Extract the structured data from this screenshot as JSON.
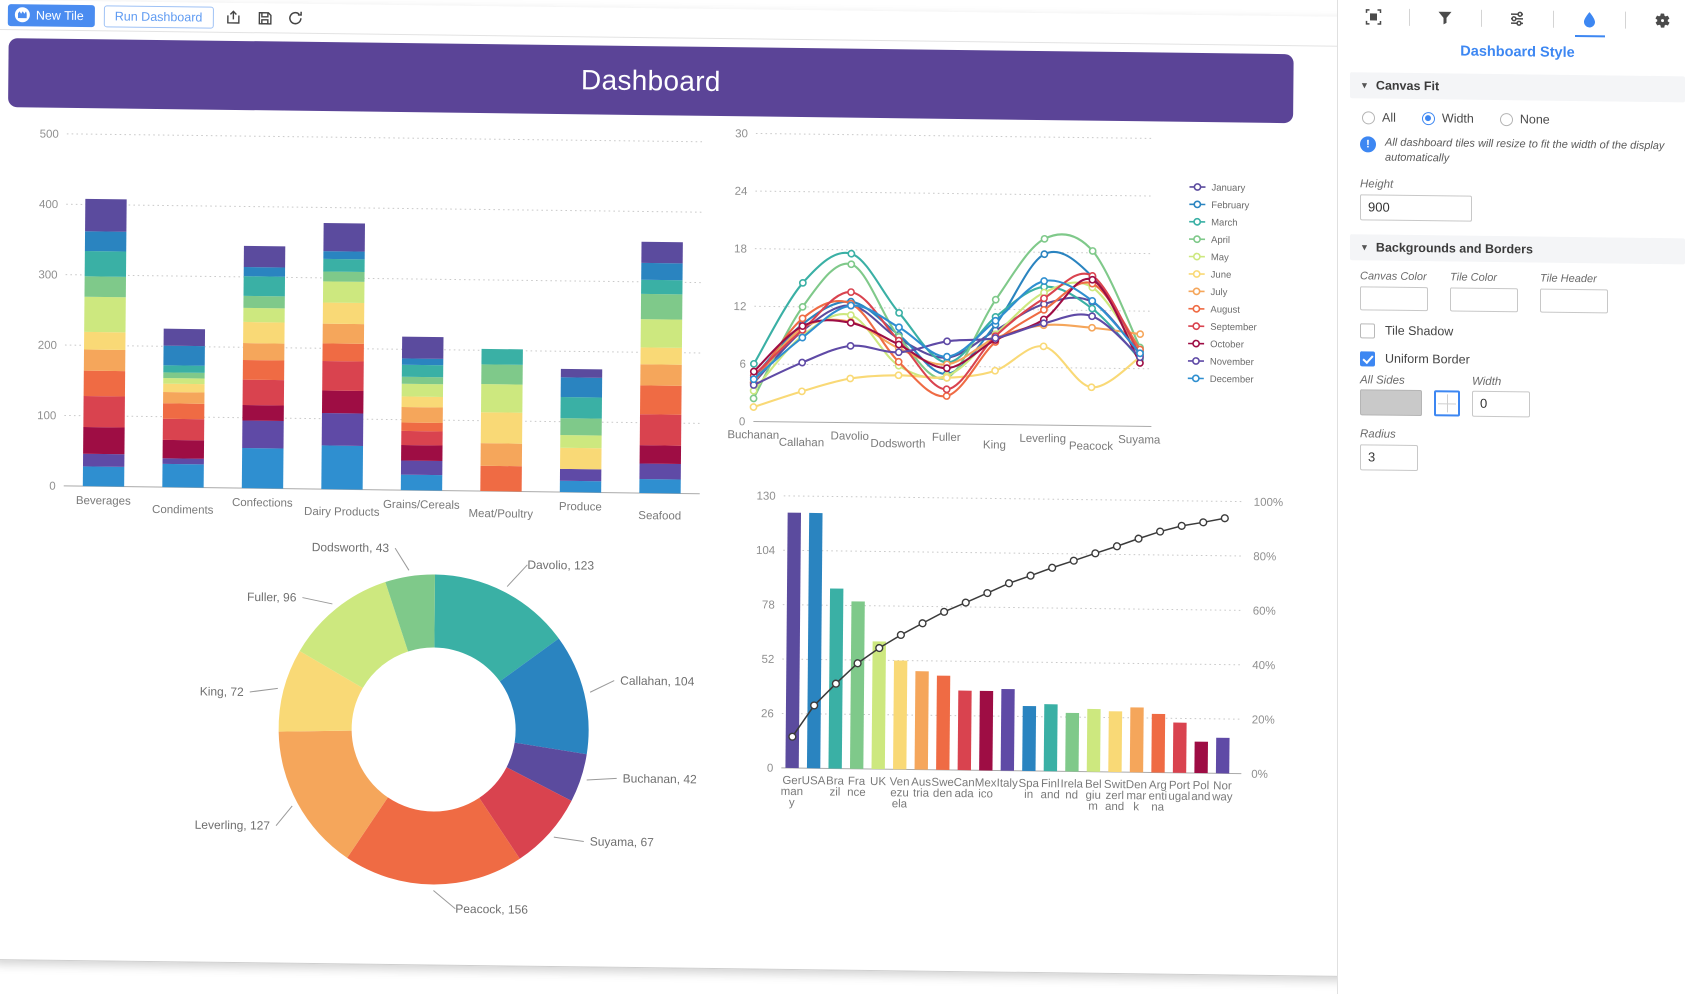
{
  "toolbar": {
    "new_tile": "New Tile",
    "run_dashboard": "Run Dashboard",
    "export_icon": "export-icon",
    "save_icon": "save-icon",
    "refresh_icon": "refresh-icon"
  },
  "banner": {
    "title": "Dashboard"
  },
  "panel": {
    "title": "Dashboard Style",
    "icons": [
      "select-tiles-icon",
      "filter-icon",
      "settings-sliders-icon",
      "style-droplet-icon",
      "gear-icon"
    ],
    "canvas_fit": {
      "heading": "Canvas Fit",
      "options": [
        "All",
        "Width",
        "None"
      ],
      "selected": "Width",
      "info": "All dashboard tiles will resize to fit the width of the display automatically",
      "height_label": "Height",
      "height_value": "900"
    },
    "backgrounds": {
      "heading": "Backgrounds and Borders",
      "canvas_color_label": "Canvas Color",
      "tile_color_label": "Tile Color",
      "tile_header_label": "Tile Header",
      "tile_shadow_label": "Tile Shadow",
      "tile_shadow_checked": false,
      "uniform_border_label": "Uniform Border",
      "uniform_border_checked": true,
      "all_sides_label": "All Sides",
      "width_label": "Width",
      "width_value": "0",
      "radius_label": "Radius",
      "radius_value": "3"
    }
  },
  "colors": {
    "accent": "#3d87f2",
    "banner": "#5b4497",
    "palette": [
      "#5b4b9e",
      "#2a84c0",
      "#3ab0a5",
      "#7fc98a",
      "#cde87f",
      "#f9d976",
      "#f5a65b",
      "#ef6b44",
      "#d9434f",
      "#9e0d44",
      "#5f4aa6",
      "#2f8fd0"
    ]
  },
  "chart_data": [
    {
      "type": "bar",
      "id": "stacked-category-bar",
      "title": "",
      "xlabel": "",
      "ylabel": "",
      "ylim": [
        0,
        500
      ],
      "yticks": [
        0,
        100,
        200,
        300,
        400,
        500
      ],
      "grid": true,
      "categories": [
        "Beverages",
        "Condiments",
        "Confections",
        "Dairy Products",
        "Grains/Cereals",
        "Meat/Poultry",
        "Produce",
        "Seafood"
      ],
      "totals": [
        408,
        225,
        344,
        378,
        218,
        202,
        175,
        357
      ],
      "stack_series": [
        "January",
        "February",
        "March",
        "April",
        "May",
        "June",
        "July",
        "August",
        "September",
        "October",
        "November",
        "December"
      ],
      "values": [
        [
          46,
          28,
          36,
          29,
          50,
          25,
          30,
          36,
          44,
          38,
          18,
          28
        ],
        [
          24,
          28,
          10,
          8,
          8,
          12,
          16,
          22,
          30,
          26,
          8,
          33
        ],
        [
          30,
          13,
          28,
          17,
          20,
          30,
          24,
          28,
          36,
          22,
          39,
          57
        ],
        [
          40,
          11,
          18,
          14,
          30,
          30,
          28,
          25,
          42,
          32,
          46,
          62
        ],
        [
          31,
          9,
          17,
          10,
          18,
          15,
          22,
          12,
          20,
          22,
          20,
          22
        ],
        [
          0,
          0,
          22,
          28,
          40,
          44,
          32,
          36,
          0,
          0,
          0,
          0
        ],
        [
          12,
          28,
          30,
          24,
          18,
          30,
          0,
          0,
          0,
          0,
          17,
          16
        ],
        [
          30,
          24,
          20,
          36,
          40,
          24,
          30,
          41,
          44,
          26,
          22,
          20
        ]
      ]
    },
    {
      "type": "line",
      "id": "monthly-employee-lines",
      "title": "",
      "xlabel": "",
      "ylabel": "",
      "ylim": [
        0,
        30
      ],
      "yticks": [
        0,
        6,
        12,
        18,
        24,
        30
      ],
      "grid": true,
      "legend_position": "right",
      "x": [
        "Buchanan",
        "Callahan",
        "Davolio",
        "Dodsworth",
        "Fuller",
        "King",
        "Leverling",
        "Peacock",
        "Suyama"
      ],
      "series": [
        {
          "name": "January",
          "color": "#5b4b9e",
          "values": [
            4.0,
            9.5,
            12.2,
            8.8,
            6.9,
            9.8,
            12.6,
            12.9,
            7.5
          ]
        },
        {
          "name": "February",
          "color": "#2a84c0",
          "values": [
            4.6,
            10.2,
            12.6,
            9.2,
            5.2,
            10.4,
            17.8,
            15.5,
            7.8
          ]
        },
        {
          "name": "March",
          "color": "#3ab0a5",
          "values": [
            6.0,
            14.5,
            17.6,
            11.5,
            6.4,
            11.2,
            14.4,
            12.2,
            7.0
          ]
        },
        {
          "name": "April",
          "color": "#7fc98a",
          "values": [
            2.4,
            12.0,
            16.5,
            9.0,
            4.8,
            13.0,
            19.4,
            18.2,
            8.2
          ]
        },
        {
          "name": "May",
          "color": "#cde87f",
          "values": [
            3.2,
            9.0,
            11.2,
            6.0,
            5.0,
            9.4,
            13.8,
            14.4,
            7.6
          ]
        },
        {
          "name": "June",
          "color": "#f9d976",
          "values": [
            1.5,
            3.2,
            4.6,
            5.0,
            4.8,
            5.6,
            8.2,
            4.0,
            7.2
          ]
        },
        {
          "name": "July",
          "color": "#f5a65b",
          "values": [
            4.2,
            9.8,
            10.5,
            7.8,
            6.2,
            9.0,
            10.4,
            10.2,
            9.6
          ]
        },
        {
          "name": "August",
          "color": "#ef6b44",
          "values": [
            4.0,
            10.8,
            12.4,
            6.4,
            2.9,
            8.6,
            12.0,
            14.8,
            8.0
          ]
        },
        {
          "name": "September",
          "color": "#d9434f",
          "values": [
            4.8,
            9.6,
            13.6,
            8.6,
            3.6,
            9.2,
            13.2,
            15.6,
            7.4
          ]
        },
        {
          "name": "October",
          "color": "#9e0d44",
          "values": [
            5.2,
            10.0,
            10.4,
            8.2,
            5.8,
            8.8,
            11.0,
            15.2,
            6.6
          ]
        },
        {
          "name": "November",
          "color": "#5f4aa6",
          "values": [
            3.8,
            6.2,
            8.0,
            7.4,
            8.6,
            9.0,
            10.6,
            11.4,
            7.2
          ]
        },
        {
          "name": "December",
          "color": "#2f8fd0",
          "values": [
            4.4,
            8.8,
            12.2,
            10.0,
            7.0,
            10.8,
            15.0,
            13.0,
            7.6
          ]
        }
      ]
    },
    {
      "type": "pie",
      "id": "employee-donut",
      "title": "",
      "donut": true,
      "labels": [
        "Davolio",
        "Callahan",
        "Buchanan",
        "Suyama",
        "Peacock",
        "Leverling",
        "King",
        "Fuller",
        "Dodsworth"
      ],
      "values": [
        123,
        104,
        42,
        67,
        156,
        127,
        72,
        96,
        43
      ],
      "colors": [
        "#3ab0a5",
        "#2a84c0",
        "#5b4b9e",
        "#d9434f",
        "#ef6b44",
        "#f5a65b",
        "#f9d976",
        "#cde87f",
        "#7fc98a"
      ],
      "annotations": [
        "Davolio, 123",
        "Callahan, 104",
        "Buchanan, 42",
        "Suyama, 67",
        "Peacock, 156",
        "Leverling, 127",
        "King, 72",
        "Fuller, 96",
        "Dodsworth, 43"
      ]
    },
    {
      "type": "bar",
      "id": "pareto-country",
      "title": "",
      "xlabel": "",
      "ylabel": "",
      "ylim": [
        0,
        130
      ],
      "yticks": [
        0,
        26,
        52,
        78,
        104,
        130
      ],
      "secondary_ylim": [
        0,
        100
      ],
      "secondary_yticks": [
        "0%",
        "20%",
        "40%",
        "60%",
        "80%",
        "100%"
      ],
      "grid": true,
      "categories": [
        "Ger\nman\ny",
        "USA",
        "Bra\nzil",
        "Fra\nnce",
        "UK",
        "Ven\nezu\nela",
        "Aus\ntria",
        "Swe\nden",
        "Can\nada",
        "Mex\nico",
        "Italy",
        "Spa\nin",
        "Finl\nand",
        "Irela\nnd",
        "Bel\ngiu\nm",
        "Swit\nzerl\nand",
        "Den\nmar\nk",
        "Arg\nenti\nna",
        "Port\nugal",
        "Pol\nand",
        "Nor\nway"
      ],
      "category_names": [
        "Germany",
        "USA",
        "Brazil",
        "France",
        "UK",
        "Venezuela",
        "Austria",
        "Sweden",
        "Canada",
        "Mexico",
        "Italy",
        "Spain",
        "Finland",
        "Ireland",
        "Belgium",
        "Switzerland",
        "Denmark",
        "Argentina",
        "Portugal",
        "Poland",
        "Norway"
      ],
      "values": [
        122,
        122,
        86,
        80,
        61,
        52,
        47,
        45,
        38,
        38,
        39,
        31,
        32,
        28,
        30,
        29,
        31,
        28,
        24,
        15,
        17
      ],
      "colors": [
        "#5b4b9e",
        "#2a84c0",
        "#3ab0a5",
        "#7fc98a",
        "#cde87f",
        "#f9d976",
        "#f5a65b",
        "#ef6b44",
        "#d9434f",
        "#9e0d44",
        "#5f4aa6",
        "#2a84c0",
        "#3ab0a5",
        "#7fc98a",
        "#cde87f",
        "#f9d976",
        "#f5a65b",
        "#ef6b44",
        "#d9434f",
        "#9e0d44",
        "#5f4aa6"
      ],
      "cumulative_percent": [
        11.5,
        23.1,
        31.2,
        38.8,
        44.5,
        49.4,
        53.8,
        58.1,
        61.6,
        65.2,
        68.9,
        71.8,
        74.8,
        77.5,
        80.3,
        83.0,
        85.9,
        88.6,
        90.8,
        92.2,
        93.8
      ]
    }
  ]
}
